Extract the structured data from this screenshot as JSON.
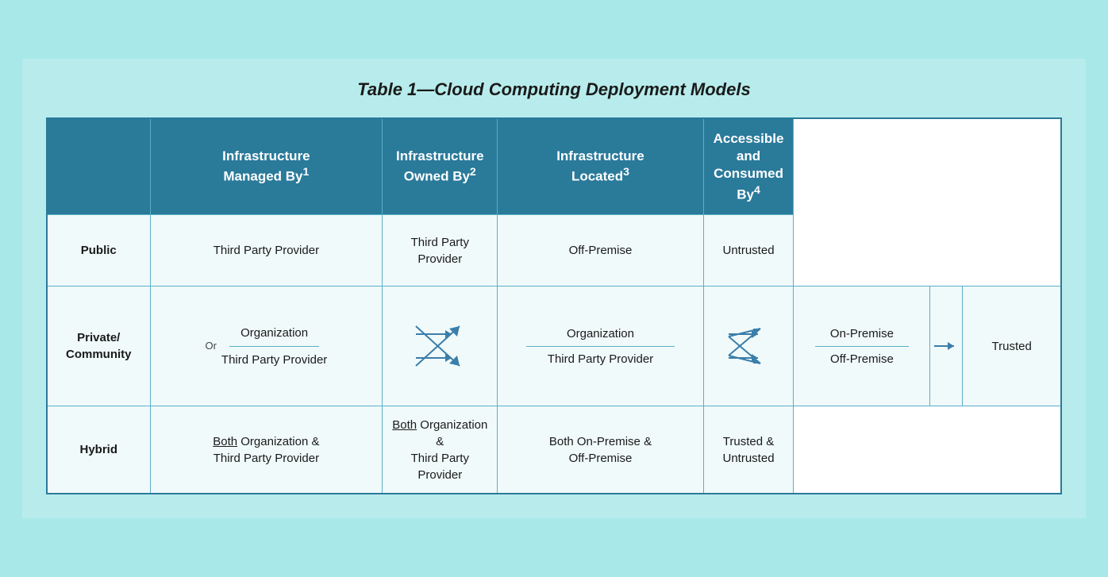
{
  "title": "Table 1—Cloud Computing Deployment Models",
  "columns": [
    {
      "id": "row-label",
      "label": ""
    },
    {
      "id": "managed-by",
      "label": "Infrastructure\nManaged By",
      "superscript": "1"
    },
    {
      "id": "owned-by",
      "label": "Infrastructure\nOwned By",
      "superscript": "2"
    },
    {
      "id": "located",
      "label": "Infrastructure\nLocated",
      "superscript": "3"
    },
    {
      "id": "consumed-by",
      "label": "Accessible and\nConsumed By",
      "superscript": "4"
    }
  ],
  "rows": {
    "public": {
      "label": "Public",
      "managed_by": "Third Party Provider",
      "owned_by": "Third Party Provider",
      "located": "Off-Premise",
      "consumed_by": "Untrusted"
    },
    "private": {
      "label": "Private/\nCommunity",
      "managed_by_top": "Organization",
      "managed_by_bottom": "Third Party Provider",
      "owned_by_top": "Organization",
      "owned_by_bottom": "Third Party Provider",
      "located_top": "On-Premise",
      "located_bottom": "Off-Premise",
      "consumed_by": "Trusted",
      "or_label": "Or"
    },
    "hybrid": {
      "label": "Hybrid",
      "managed_by_line1": "Both",
      "managed_by_line2": "Organization &",
      "managed_by_line3": "Third Party Provider",
      "owned_by_line1": "Both",
      "owned_by_line2": "Organization &",
      "owned_by_line3": "Third Party Provider",
      "located_line1": "Both On-Premise &",
      "located_line2": "Off-Premise",
      "consumed_by_line1": "Trusted &",
      "consumed_by_line2": "Untrusted"
    }
  }
}
